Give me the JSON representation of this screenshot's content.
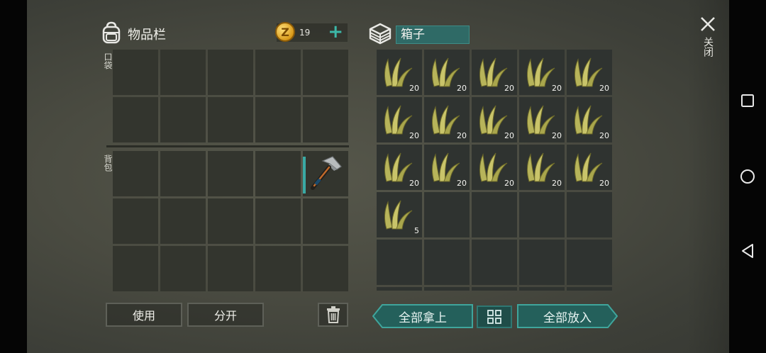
{
  "inventory": {
    "title": "物品栏",
    "coins": "19",
    "add_coins": "+"
  },
  "labels": {
    "pocket": "口袋",
    "backpack": "背包"
  },
  "box": {
    "title": "箱子"
  },
  "box_items": [
    {
      "qty": "20"
    },
    {
      "qty": "20"
    },
    {
      "qty": "20"
    },
    {
      "qty": "20"
    },
    {
      "qty": "20"
    },
    {
      "qty": "20"
    },
    {
      "qty": "20"
    },
    {
      "qty": "20"
    },
    {
      "qty": "20"
    },
    {
      "qty": "20"
    },
    {
      "qty": "20"
    },
    {
      "qty": "20"
    },
    {
      "qty": "20"
    },
    {
      "qty": "20"
    },
    {
      "qty": "20"
    },
    {
      "qty": "5"
    }
  ],
  "buttons": {
    "use": "使用",
    "split": "分开",
    "take_all": "全部拿上",
    "put_all": "全部放入"
  },
  "close": {
    "label": "关闭",
    "icon": "close-icon"
  },
  "colors": {
    "accent": "#3aa9a4",
    "coin": "#e0a020",
    "panel": "#33352e"
  }
}
